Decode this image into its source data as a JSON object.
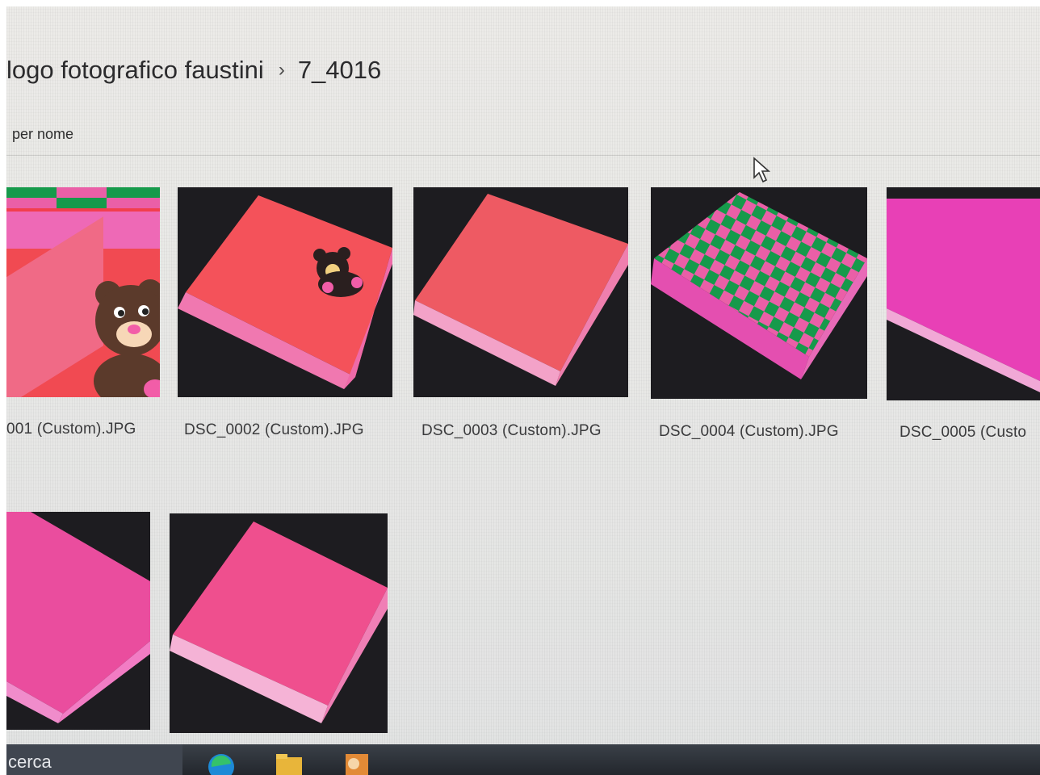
{
  "breadcrumb": {
    "parent": "logo fotografico faustini",
    "separator": "›",
    "current": "7_4016"
  },
  "sort": {
    "label": "per nome"
  },
  "files": [
    {
      "name": "001 (Custom).JPG",
      "cover": "#f2505f",
      "design": "bear-closeup"
    },
    {
      "name": "DSC_0002 (Custom).JPG",
      "cover": "#f4525a",
      "design": "bear-badge"
    },
    {
      "name": "DSC_0003 (Custom).JPG",
      "cover": "#ee5a63",
      "design": "plain"
    },
    {
      "name": "DSC_0004 (Custom).JPG",
      "cover": "#e9479e",
      "design": "checkerboard"
    },
    {
      "name": "DSC_0005 (Custo",
      "cover": "#e840b6",
      "design": "plain"
    },
    {
      "name": "",
      "cover": "#ea4d9e",
      "design": "plain"
    },
    {
      "name": "",
      "cover": "#ef4f8e",
      "design": "plain"
    }
  ],
  "colors": {
    "checker_green": "#169a4b",
    "checker_pink": "#ea5fa7",
    "bear_brown": "#5b3a2b",
    "bear_pink": "#f25da8"
  },
  "taskbar": {
    "search_text": "cerca",
    "icons": [
      "edge-icon",
      "folder-icon",
      "outlook-icon"
    ]
  }
}
